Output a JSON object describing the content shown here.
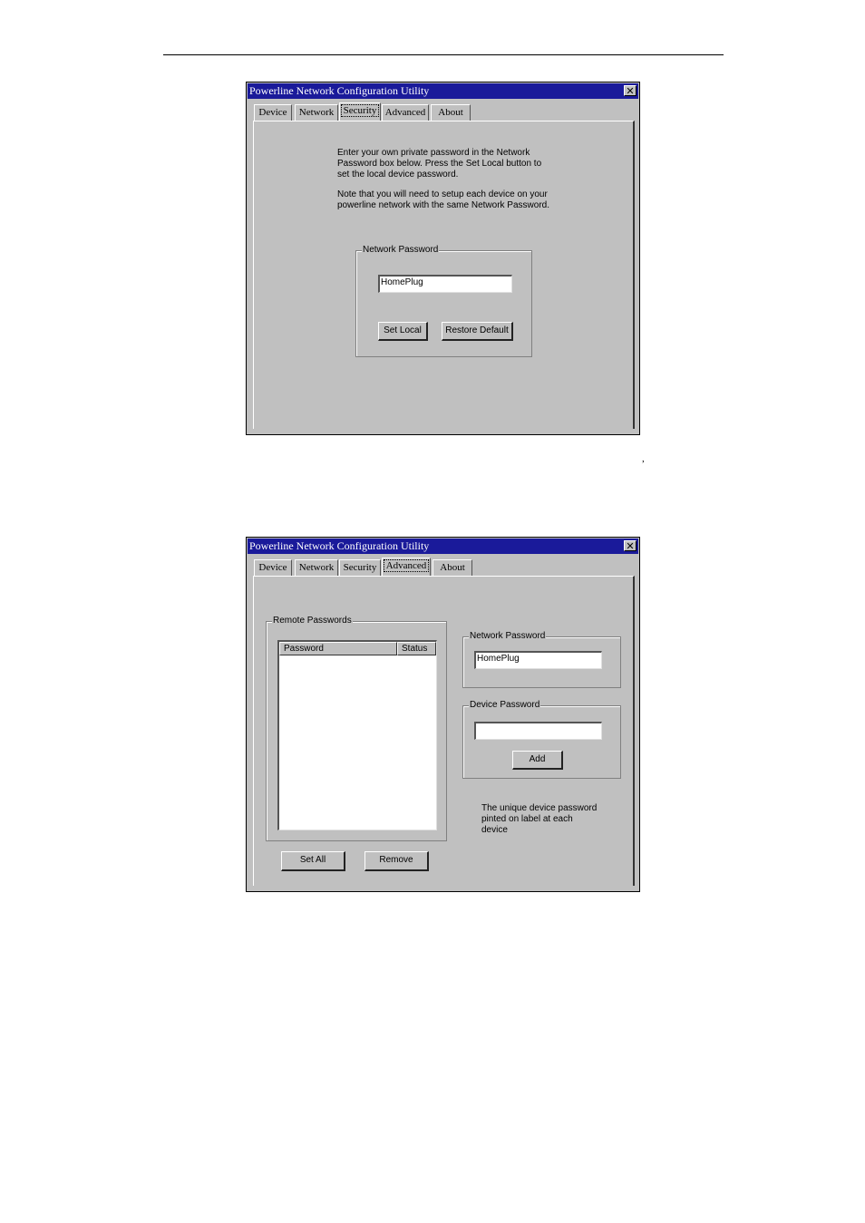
{
  "window1": {
    "title": "Powerline Network Configuration Utility",
    "close_glyph": "✕",
    "tabs": [
      "Device",
      "Network",
      "Security",
      "Advanced",
      "About"
    ],
    "active_tab": "Security",
    "instructions_1": [
      "Enter your own private password in the Network",
      "Password box below. Press the Set Local button to",
      "set the local device password."
    ],
    "instructions_2": [
      "Note that you will need to setup each device on your",
      "powerline network with the same Network Password."
    ],
    "network_password_group": "Network Password",
    "network_password_value": "HomePlug",
    "set_local_label": "Set Local",
    "restore_default_label": "Restore Default"
  },
  "stray_mark": ",",
  "window2": {
    "title": "Powerline Network Configuration Utility",
    "close_glyph": "✕",
    "tabs": [
      "Device",
      "Network",
      "Security",
      "Advanced",
      "About"
    ],
    "active_tab": "Advanced",
    "remote_passwords_group": "Remote Passwords",
    "columns": [
      "Password",
      "Status"
    ],
    "rows": [],
    "network_password_group": "Network Password",
    "network_password_value": "HomePlug",
    "device_password_group": "Device Password",
    "device_password_value": "",
    "add_label": "Add",
    "note": [
      "The unique device password",
      "pinted on label at each",
      "device"
    ],
    "set_all_label": "Set All",
    "remove_label": "Remove"
  }
}
